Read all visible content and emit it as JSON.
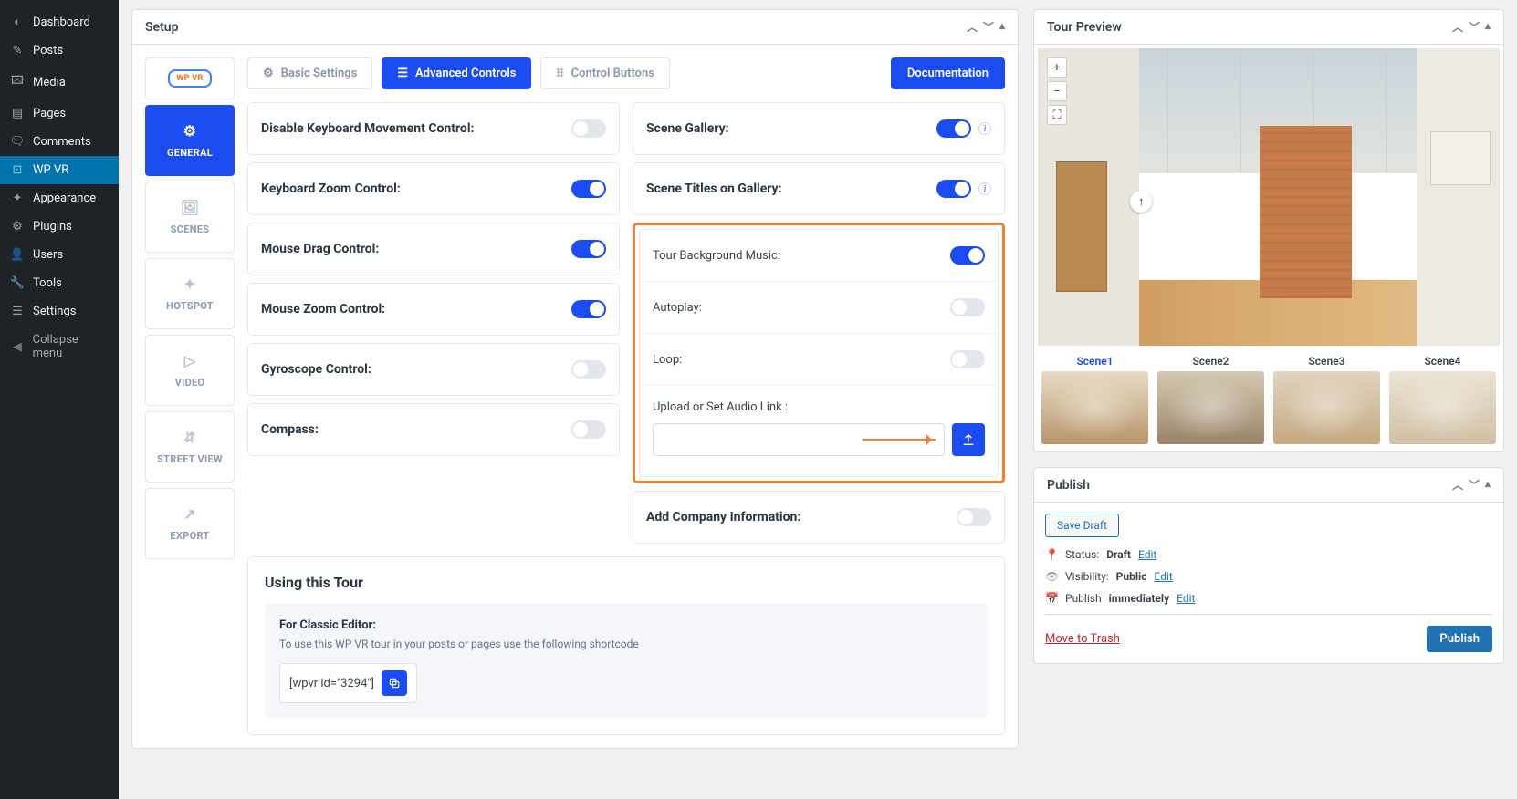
{
  "wp_sidebar": [
    {
      "icon": "◐",
      "label": "Dashboard"
    },
    {
      "icon": "✎",
      "label": "Posts"
    },
    {
      "icon": "🖾",
      "label": "Media"
    },
    {
      "icon": "▤",
      "label": "Pages"
    },
    {
      "icon": "🗨",
      "label": "Comments"
    },
    {
      "icon": "⊡",
      "label": "WP VR",
      "active": true
    },
    {
      "icon": "✦",
      "label": "Appearance"
    },
    {
      "icon": "⚙",
      "label": "Plugins"
    },
    {
      "icon": "👤",
      "label": "Users"
    },
    {
      "icon": "🔧",
      "label": "Tools"
    },
    {
      "icon": "☰",
      "label": "Settings"
    },
    {
      "icon": "◀",
      "label": "Collapse menu",
      "collapse": true
    }
  ],
  "setup": {
    "title": "Setup",
    "logo_text": "WP VR",
    "tabs": [
      {
        "icon": "⚙",
        "label": "GENERAL",
        "active": true
      },
      {
        "icon": "🖼",
        "label": "SCENES"
      },
      {
        "icon": "✦",
        "label": "HOTSPOT"
      },
      {
        "icon": "▷",
        "label": "VIDEO"
      },
      {
        "icon": "⇵",
        "label": "STREET VIEW"
      },
      {
        "icon": "↗",
        "label": "EXPORT"
      }
    ],
    "pills": [
      {
        "icon": "⚙",
        "label": "Basic Settings"
      },
      {
        "icon": "☰",
        "label": "Advanced Controls",
        "active": true
      },
      {
        "icon": "⁝⁝",
        "label": "Control Buttons"
      }
    ],
    "doc_label": "Documentation",
    "controls_left": [
      {
        "label": "Disable Keyboard Movement Control:",
        "on": false
      },
      {
        "label": "Keyboard Zoom Control:",
        "on": true
      },
      {
        "label": "Mouse Drag Control:",
        "on": true
      },
      {
        "label": "Mouse Zoom Control:",
        "on": true
      },
      {
        "label": "Gyroscope Control:",
        "on": false
      },
      {
        "label": "Compass:",
        "on": false
      }
    ],
    "controls_right_top": [
      {
        "label": "Scene Gallery:",
        "on": true,
        "info": true
      },
      {
        "label": "Scene Titles on Gallery:",
        "on": true,
        "info": true
      }
    ],
    "bg_music": {
      "title": "Tour Background Music:",
      "on": true,
      "autoplay_label": "Autoplay:",
      "autoplay_on": false,
      "loop_label": "Loop:",
      "loop_on": false,
      "upload_label": "Upload or Set Audio Link :",
      "value": ""
    },
    "company_info": {
      "label": "Add Company Information:",
      "on": false
    },
    "using": {
      "title": "Using this Tour",
      "classic_title": "For Classic Editor:",
      "classic_desc": "To use this WP VR tour in your posts or pages use the following shortcode",
      "shortcode": "[wpvr id=\"3294\"]"
    }
  },
  "preview": {
    "title": "Tour Preview",
    "scenes": [
      {
        "label": "Scene1",
        "active": true
      },
      {
        "label": "Scene2"
      },
      {
        "label": "Scene3"
      },
      {
        "label": "Scene4"
      }
    ]
  },
  "publish": {
    "title": "Publish",
    "save_draft": "Save Draft",
    "status_label": "Status:",
    "status_value": "Draft",
    "visibility_label": "Visibility:",
    "visibility_value": "Public",
    "publish_label": "Publish",
    "publish_value": "immediately",
    "edit": "Edit",
    "trash": "Move to Trash",
    "publish_btn": "Publish"
  }
}
